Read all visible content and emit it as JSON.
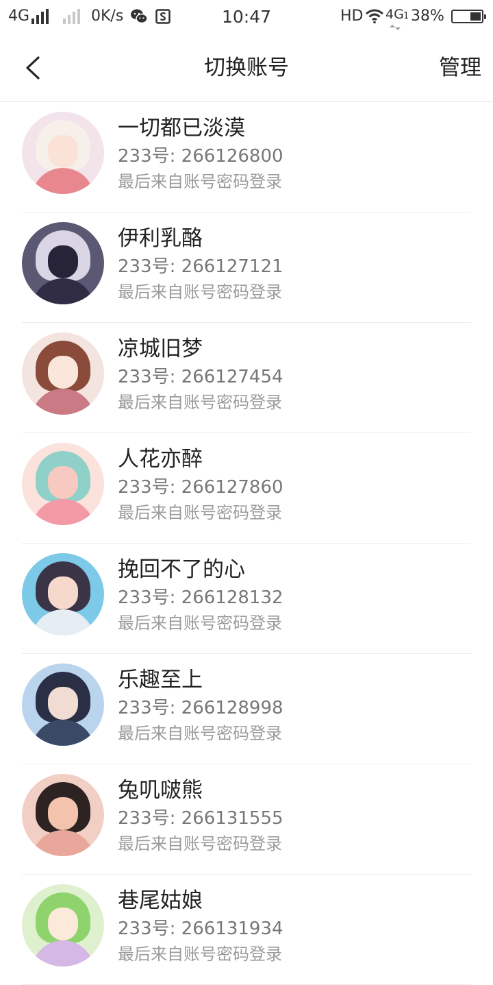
{
  "status_bar": {
    "network_left": "4G",
    "speed": "0K/s",
    "time": "10:47",
    "hd": "HD",
    "network_right": "4G",
    "network_right_sub": "1",
    "battery_percent": "38%",
    "battery_level": 0.38
  },
  "header": {
    "title": "切换账号",
    "manage_label": "管理"
  },
  "accounts": [
    {
      "name": "一切都已淡漠",
      "uid": "233号: 266126800",
      "note": "最后来自账号密码登录",
      "colors": {
        "bg": "#f3e3ea",
        "hair": "#f7efe9",
        "face": "#fbe2d6",
        "body": "#e9878f"
      }
    },
    {
      "name": "伊利乳酪",
      "uid": "233号: 266127121",
      "note": "最后来自账号密码登录",
      "colors": {
        "bg": "#5b5873",
        "hair": "#d9d5e4",
        "face": "#27243a",
        "body": "#2f2c44"
      }
    },
    {
      "name": "凉城旧梦",
      "uid": "233号: 266127454",
      "note": "最后来自账号密码登录",
      "colors": {
        "bg": "#f3e4df",
        "hair": "#8a4b3a",
        "face": "#fbe6dc",
        "body": "#c97a84"
      }
    },
    {
      "name": "人花亦醉",
      "uid": "233号: 266127860",
      "note": "最后来自账号密码登录",
      "colors": {
        "bg": "#fbe2dc",
        "hair": "#8fd0c9",
        "face": "#f7c9c0",
        "body": "#f39aa6"
      }
    },
    {
      "name": "挽回不了的心",
      "uid": "233号: 266128132",
      "note": "最后来自账号密码登录",
      "colors": {
        "bg": "#7cc9e8",
        "hair": "#3b3447",
        "face": "#f6d9cc",
        "body": "#e6eef4"
      }
    },
    {
      "name": "乐趣至上",
      "uid": "233号: 266128998",
      "note": "最后来自账号密码登录",
      "colors": {
        "bg": "#b9d4ec",
        "hair": "#2a2f45",
        "face": "#f0dcd2",
        "body": "#3a4a66"
      }
    },
    {
      "name": "兔叽啵熊",
      "uid": "233号: 266131555",
      "note": "最后来自账号密码登录",
      "colors": {
        "bg": "#f2cfc4",
        "hair": "#2c2322",
        "face": "#f3c3ae",
        "body": "#e9a79c"
      }
    },
    {
      "name": "巷尾姑娘",
      "uid": "233号: 266131934",
      "note": "最后来自账号密码登录",
      "colors": {
        "bg": "#dff0cf",
        "hair": "#8ed36b",
        "face": "#fbe9da",
        "body": "#d6b8e6"
      }
    }
  ]
}
